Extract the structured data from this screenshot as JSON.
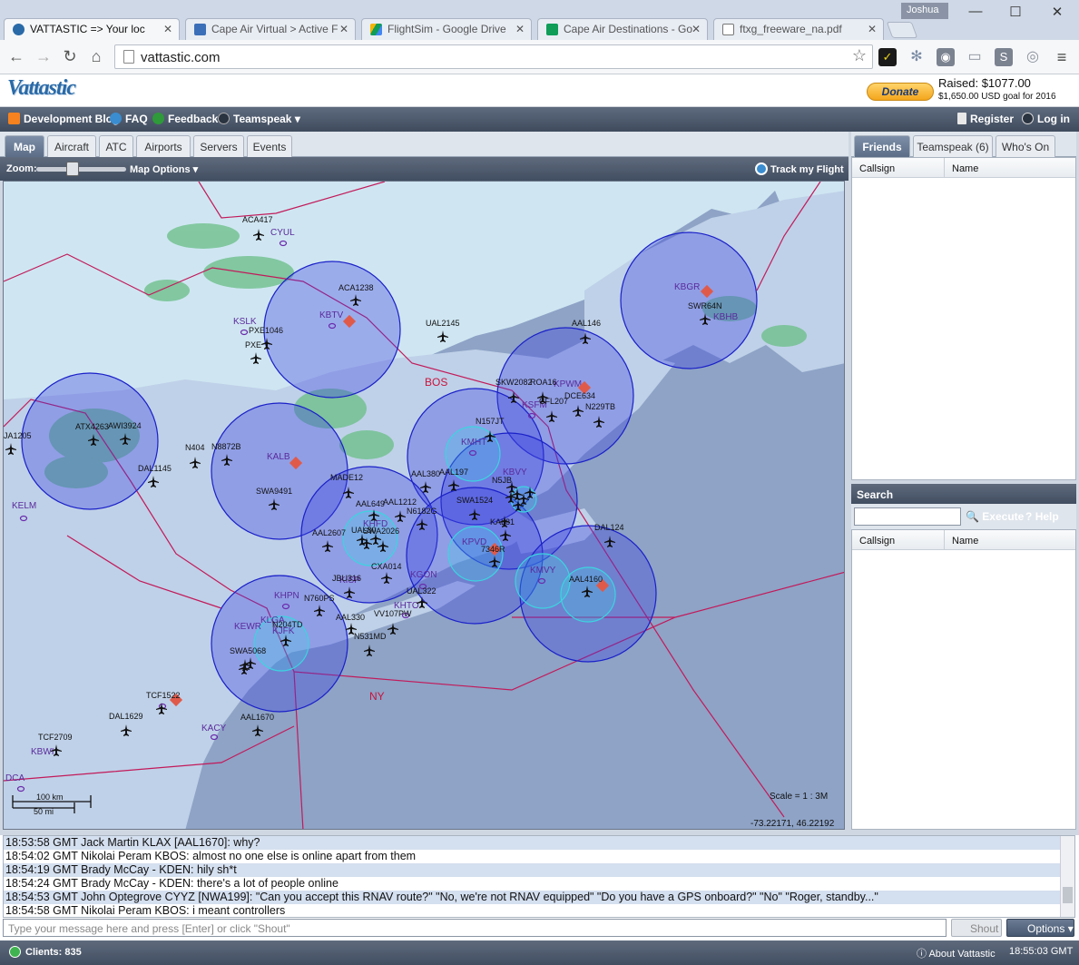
{
  "browser": {
    "tabs": [
      {
        "title": "VATTASTIC => Your loc",
        "icon": "globe-icon",
        "active": true
      },
      {
        "title": "Cape Air Virtual > Active F",
        "icon": "plane-icon",
        "active": false
      },
      {
        "title": "FlightSim - Google Drive",
        "icon": "drive-icon",
        "active": false
      },
      {
        "title": "Cape Air Destinations - Go",
        "icon": "sheets-icon",
        "active": false
      },
      {
        "title": "ftxg_freeware_na.pdf",
        "icon": "document-icon",
        "active": false
      }
    ],
    "user": "Joshua",
    "url": "vattastic.com"
  },
  "header": {
    "logo": "Vattastic",
    "donate_label": "Donate",
    "raised": "Raised: $1077.00",
    "goal": "$1,650.00 USD goal for 2016"
  },
  "nav": {
    "dev_blog": "Development Blog",
    "faq": "FAQ",
    "feedback": "Feedback",
    "teamspeak": "Teamspeak",
    "register": "Register",
    "login": "Log in"
  },
  "main_tabs": [
    "Map",
    "Aircraft",
    "ATC",
    "Airports",
    "Servers",
    "Events"
  ],
  "map_bar": {
    "zoom_label": "Zoom:",
    "map_options": "Map Options",
    "track_flight": "Track my Flight"
  },
  "map": {
    "scale": "Scale = 1 : 3M",
    "coords": "-73.22171, 46.22192",
    "scalebar_km": "100 km",
    "scalebar_mi": "50 mi",
    "regions": [
      "BOS",
      "NY"
    ],
    "airports": [
      "CYUL",
      "KSLK",
      "KBTV",
      "KBGR",
      "KBHB",
      "KPWM",
      "KSFM",
      "KMHT",
      "KALB",
      "KBVY",
      "KPVD",
      "KMVY",
      "KGON",
      "KHPN",
      "KHTO",
      "KLGA",
      "KEWR",
      "KACY",
      "KBWI",
      "KELM",
      "DCA",
      "KJFK",
      "KHFD",
      "KISP"
    ],
    "aircraft": [
      "ACA417",
      "ACA1238",
      "PXE1046",
      "PXE",
      "UAL2145",
      "AAL146",
      "SWR64N",
      "SKW2082",
      "ROA16",
      "CFL207",
      "DCE634",
      "N229TB",
      "N157JT",
      "ATX4263",
      "AWI3924",
      "JA1205",
      "N404",
      "N8872B",
      "DAL1145",
      "AAL380",
      "AAL197",
      "MADE12",
      "SWA9491",
      "AAL649",
      "AAL1212",
      "N6182G",
      "SWA1524",
      "AAL2607",
      "UAL80",
      "SWA2026",
      "KAL81",
      "7346R",
      "DAL124",
      "AAL4160",
      "JBU316",
      "CXA014",
      "UAL322",
      "N760PS",
      "AAL330",
      "VV107PW",
      "N204TD",
      "N531MD",
      "SWA5068",
      "TCF1522",
      "DAL1629",
      "AAL1670",
      "TCF2709",
      "N5JB"
    ]
  },
  "right_panel": {
    "tabs": [
      "Friends",
      "Teamspeak (6)",
      "Who's On"
    ],
    "col_callsign": "Callsign",
    "col_name": "Name",
    "search_title": "Search",
    "execute": "Execute",
    "help": "Help"
  },
  "chat": {
    "lines": [
      "18:53:58 GMT  Jack Martin KLAX [AAL1670]: why?",
      "18:54:02 GMT  Nikolai Peram KBOS: almost no one else is online apart from them",
      "18:54:19 GMT  Brady McCay - KDEN: hily sh*t",
      "18:54:24 GMT  Brady McCay - KDEN: there's a lot of people online",
      "18:54:53 GMT  John Optegrove CYYZ [NWA199]: \"Can you accept this RNAV route?\" \"No, we're not RNAV equipped\" \"Do you have a GPS onboard?\" \"No\" \"Roger, standby...\"",
      "18:54:58 GMT  Nikolai Peram KBOS: i meant controllers"
    ],
    "placeholder": "Type your message here and press [Enter] or click \"Shout\"",
    "shout": "Shout",
    "options": "Options"
  },
  "status": {
    "clients": "Clients: 835",
    "about": "About Vattastic",
    "clock": "18:55:03 GMT"
  },
  "colors": {
    "sea": "#8ea3c6",
    "land": "#bfd1e8",
    "canada": "#cfe6f2",
    "nav": "#4a5669",
    "atc_circle": "#2630d8",
    "tower_circle": "#3cd4e0"
  }
}
